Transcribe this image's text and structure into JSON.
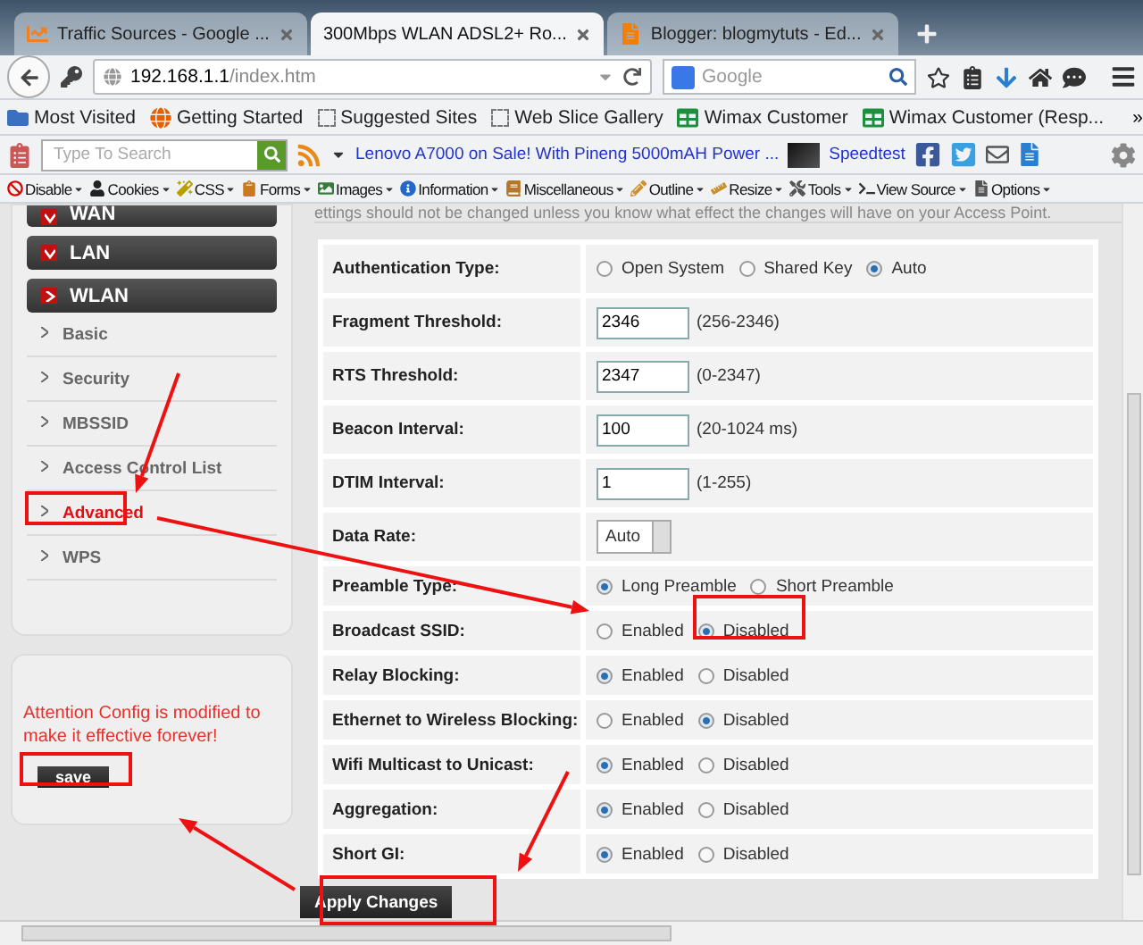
{
  "tabs": [
    {
      "title": "Traffic Sources - Google ...",
      "kind": "chart",
      "selected": false
    },
    {
      "title": "300Mbps WLAN ADSL2+ Ro...",
      "kind": "plain",
      "selected": true
    },
    {
      "title": "Blogger: blogmytuts - Ed...",
      "kind": "blogger",
      "selected": false
    }
  ],
  "address": {
    "host": "192.168.1.1",
    "path": "/index.htm"
  },
  "search": {
    "placeholder": "Google"
  },
  "bookmarks": [
    {
      "label": "Most Visited",
      "kind": "folder"
    },
    {
      "label": "Getting Started",
      "kind": "browser"
    },
    {
      "label": "Suggested Sites",
      "kind": "dotted"
    },
    {
      "label": "Web Slice Gallery",
      "kind": "dotted"
    },
    {
      "label": "Wimax Customer",
      "kind": "sheet"
    },
    {
      "label": "Wimax Customer (Resp...",
      "kind": "sheet"
    }
  ],
  "bookmarks_more": "»",
  "addon_bar": {
    "search_placeholder": "Type To Search",
    "ticker": "Lenovo A7000 on Sale! With Pineng 5000mAH Power ...",
    "speedtest": "Speedtest"
  },
  "dev_toolbar": [
    "Disable",
    "Cookies",
    "CSS",
    "Forms",
    "Images",
    "Information",
    "Miscellaneous",
    "Outline",
    "Resize",
    "Tools",
    "View Source",
    "Options"
  ],
  "sidebar": {
    "sections": [
      {
        "label": "WAN",
        "expanded": false
      },
      {
        "label": "LAN",
        "expanded": false
      },
      {
        "label": "WLAN",
        "expanded": true
      }
    ],
    "items": [
      {
        "label": "Basic",
        "selected": false
      },
      {
        "label": "Security",
        "selected": false
      },
      {
        "label": "MBSSID",
        "selected": false
      },
      {
        "label": "Access Control List",
        "selected": false
      },
      {
        "label": "Advanced",
        "selected": true
      },
      {
        "label": "WPS",
        "selected": false
      }
    ],
    "notice": "Attention Config is modified to make it effective forever!",
    "save": "save"
  },
  "settings": {
    "intro": "ettings should not be changed unless you know what effect the changes will have on your Access Point.",
    "rows": [
      {
        "label": "Authentication Type:",
        "kind": "radio",
        "options": [
          {
            "label": "Open System",
            "selected": false
          },
          {
            "label": "Shared Key",
            "selected": false
          },
          {
            "label": "Auto",
            "selected": true
          }
        ]
      },
      {
        "label": "Fragment Threshold:",
        "kind": "input",
        "value": "2346",
        "hint": "(256-2346)"
      },
      {
        "label": "RTS Threshold:",
        "kind": "input",
        "value": "2347",
        "hint": "(0-2347)"
      },
      {
        "label": "Beacon Interval:",
        "kind": "input",
        "value": "100",
        "hint": "(20-1024 ms)"
      },
      {
        "label": "DTIM Interval:",
        "kind": "input",
        "value": "1",
        "hint": "(1-255)"
      },
      {
        "label": "Data Rate:",
        "kind": "select",
        "value": "Auto"
      },
      {
        "label": "Preamble Type:",
        "kind": "radio",
        "options": [
          {
            "label": "Long Preamble",
            "selected": true
          },
          {
            "label": "Short Preamble",
            "selected": false
          }
        ]
      },
      {
        "label": "Broadcast SSID:",
        "kind": "radio",
        "options": [
          {
            "label": "Enabled",
            "selected": false
          },
          {
            "label": "Disabled",
            "selected": true
          }
        ]
      },
      {
        "label": "Relay Blocking:",
        "kind": "radio",
        "options": [
          {
            "label": "Enabled",
            "selected": true
          },
          {
            "label": "Disabled",
            "selected": false
          }
        ]
      },
      {
        "label": "Ethernet to Wireless Blocking:",
        "kind": "radio",
        "options": [
          {
            "label": "Enabled",
            "selected": false
          },
          {
            "label": "Disabled",
            "selected": true
          }
        ]
      },
      {
        "label": "Wifi Multicast to Unicast:",
        "kind": "radio",
        "options": [
          {
            "label": "Enabled",
            "selected": true
          },
          {
            "label": "Disabled",
            "selected": false
          }
        ]
      },
      {
        "label": "Aggregation:",
        "kind": "radio",
        "options": [
          {
            "label": "Enabled",
            "selected": true
          },
          {
            "label": "Disabled",
            "selected": false
          }
        ]
      },
      {
        "label": "Short GI:",
        "kind": "radio",
        "options": [
          {
            "label": "Enabled",
            "selected": true
          },
          {
            "label": "Disabled",
            "selected": false
          }
        ]
      }
    ],
    "apply": "Apply Changes"
  }
}
